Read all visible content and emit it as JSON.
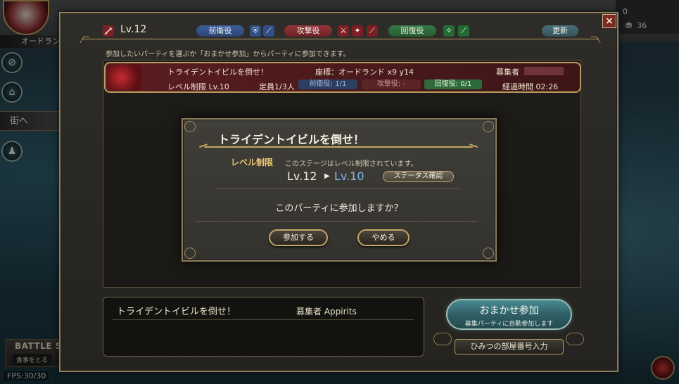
{
  "hud": {
    "player_name": "オードラン",
    "town_label": "街へ",
    "right_values": [
      "0",
      "36"
    ],
    "battle_title": "BATTLE ST",
    "battle_sub": "食事をとる",
    "fps": "FPS:30/30"
  },
  "header": {
    "level": "Lv.12",
    "roles": {
      "front": "前衛役",
      "attack": "攻撃役",
      "heal": "回復役"
    },
    "refresh_label": "更新",
    "close_label": "×"
  },
  "instruction": "参加したいパーティを選ぶか「おまかせ参加」からパーティに参加できます。",
  "party": {
    "title": "トライデントイビルを倒せ！",
    "coords": "座標：オードランド x9 y14",
    "recruiter_label": "募集者",
    "level_limit": "レベル制限 Lv.10",
    "capacity": "定員1/3人",
    "front_slot": "前衛役: 1/1",
    "attack_slot": "攻撃役: -",
    "heal_slot": "回復役: 0/1",
    "elapsed": "経過時間 02:26"
  },
  "detail": {
    "title": "トライデントイビルを倒せ！",
    "recruiter": "募集者 Appirits"
  },
  "auto_join": {
    "label": "おまかせ参加",
    "sub": "募集パーティに自動参加します"
  },
  "secret_label": "ひみつの部屋番号入力",
  "dialog": {
    "title": "トライデントイビルを倒せ！",
    "level_label": "レベル制限",
    "level_desc": "このステージはレベル制限されています。",
    "current_level": "Lv.12",
    "arrow": "▶",
    "new_level": "Lv.10",
    "status_button": "ステータス確認",
    "question": "このパーティに参加しますか？",
    "join_button": "参加する",
    "cancel_button": "やめる"
  },
  "colors": {
    "accent_gold": "#c4a664",
    "front_blue": "#3b5f9a",
    "attack_red": "#93353a",
    "heal_green": "#357a45",
    "new_level_blue": "#86b8ef"
  }
}
